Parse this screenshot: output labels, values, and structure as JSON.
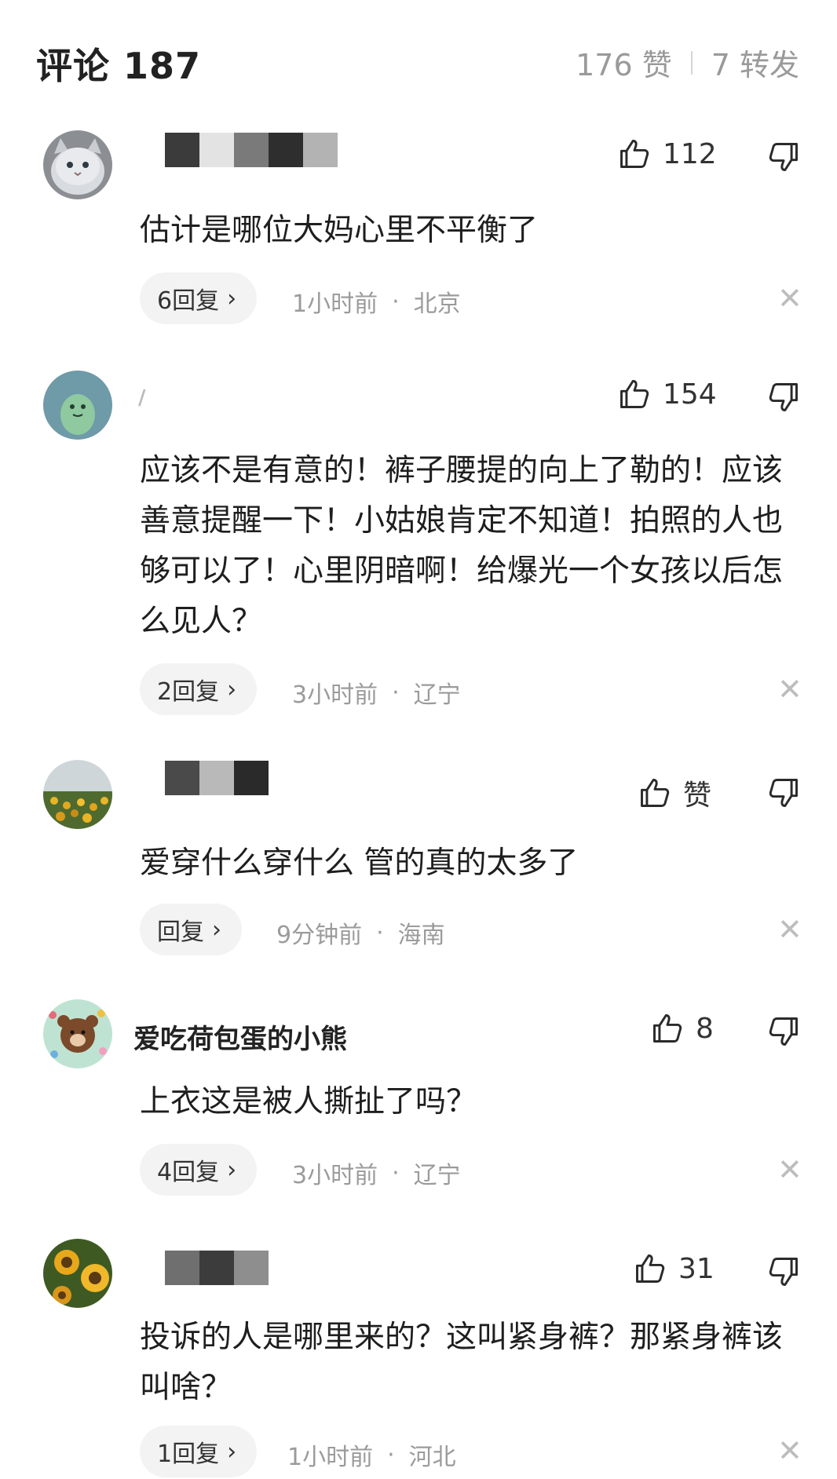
{
  "header": {
    "title": "评论 187",
    "likes": "176 赞",
    "shares": "7 转发"
  },
  "comments": [
    {
      "name": "",
      "likes": "112",
      "text": "估计是哪位大妈心里不平衡了",
      "reply": "6回复",
      "time": "1小时前",
      "location": "北京"
    },
    {
      "name": "",
      "likes": "154",
      "text": "应该不是有意的！裤子腰提的向上了勒的！应该善意提醒一下！小姑娘肯定不知道！拍照的人也够可以了！心里阴暗啊！给爆光一个女孩以后怎么见人？",
      "reply": "2回复",
      "time": "3小时前",
      "location": "辽宁"
    },
    {
      "name": "",
      "likes": "赞",
      "text": "爱穿什么穿什么 管的真的太多了",
      "reply": "回复",
      "time": "9分钟前",
      "location": "海南"
    },
    {
      "name": "爱吃荷包蛋的小熊",
      "likes": "8",
      "text": "上衣这是被人撕扯了吗？",
      "reply": "4回复",
      "time": "3小时前",
      "location": "辽宁"
    },
    {
      "name": "",
      "likes": "31",
      "text": "投诉的人是哪里来的？这叫紧身裤？那紧身裤该叫啥？",
      "reply": "1回复",
      "time": "1小时前",
      "location": "河北"
    }
  ],
  "icons": {
    "like": "thumbs-up-icon",
    "dislike": "thumbs-down-icon",
    "close": "close-icon",
    "chevron": "chevron-right-icon"
  },
  "glyphs": {
    "chevron": "›",
    "close": "✕",
    "dot": "·"
  }
}
